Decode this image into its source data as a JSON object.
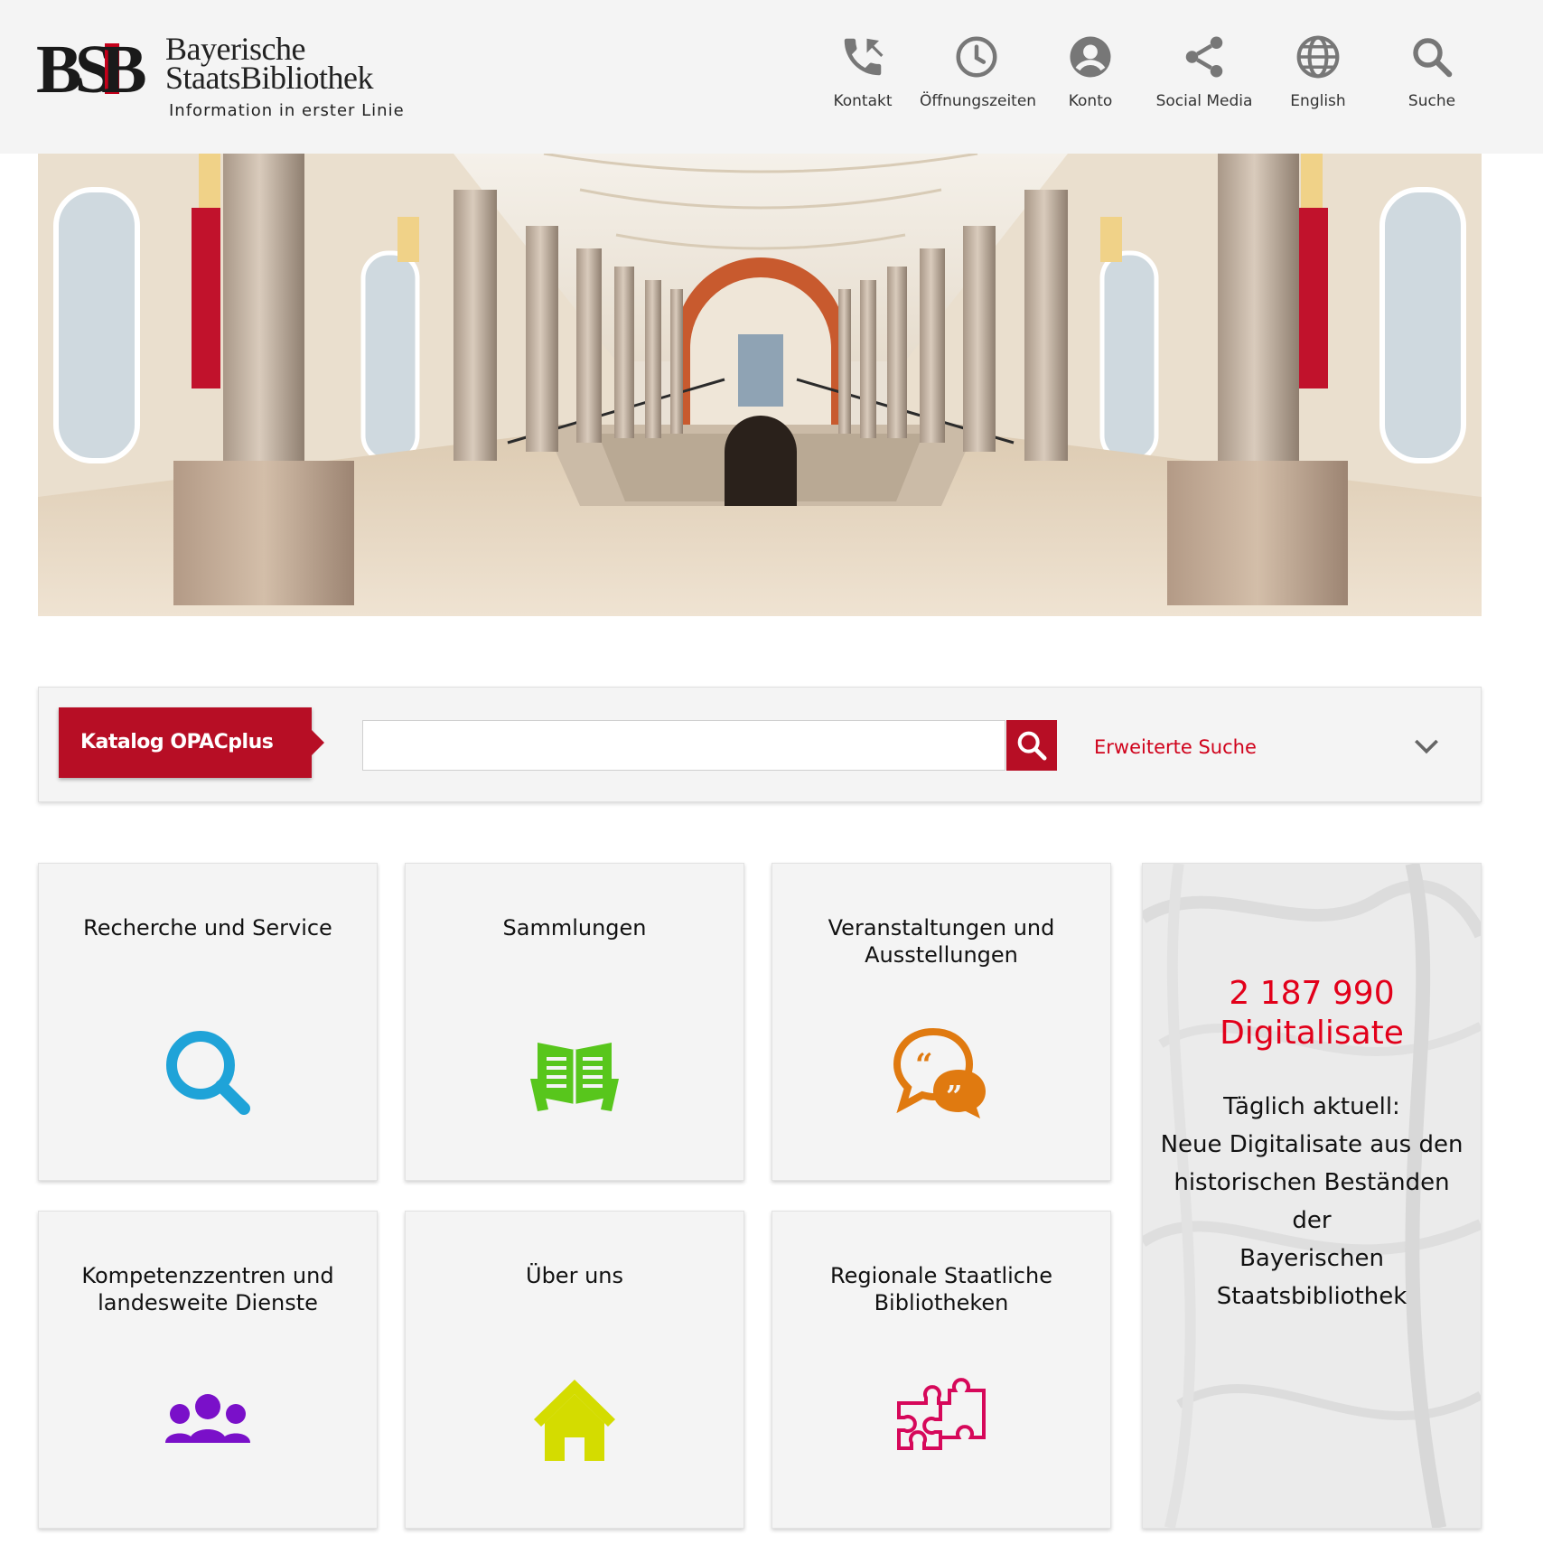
{
  "header": {
    "logo_mark": "BSB",
    "logo_name_line1": "Bayerische",
    "logo_name_line2": "StaatsBibliothek",
    "logo_tagline": "Information in erster Linie",
    "nav": [
      {
        "label": "Kontakt",
        "icon": "phone-icon"
      },
      {
        "label": "Öffnungszeiten",
        "icon": "clock-icon"
      },
      {
        "label": "Konto",
        "icon": "account-icon"
      },
      {
        "label": "Social Media",
        "icon": "share-icon"
      },
      {
        "label": "English",
        "icon": "globe-icon"
      },
      {
        "label": "Suche",
        "icon": "search-icon"
      }
    ]
  },
  "search": {
    "catalog_label": "Katalog OPACplus",
    "input_value": "",
    "advanced_label": "Erweiterte Suche"
  },
  "tiles": [
    {
      "title": "Recherche und Service",
      "icon": "magnifier-icon",
      "color": "#1fa3d8"
    },
    {
      "title": "Sammlungen",
      "icon": "open-book-icon",
      "color": "#58c61c"
    },
    {
      "title": "Veranstaltungen und Ausstellungen",
      "icon": "speech-bubbles-icon",
      "color": "#e07a10"
    },
    {
      "title": "Kompetenzzentren und landesweite Dienste",
      "icon": "people-icon",
      "color": "#7a10c9"
    },
    {
      "title": "Über uns",
      "icon": "house-icon",
      "color": "#d4dc00"
    },
    {
      "title": "Regionale Staatliche Bibliotheken",
      "icon": "puzzle-icon",
      "color": "#d6085a"
    }
  ],
  "digitalisate": {
    "count": "2 187 990",
    "label": "Digitalisate",
    "text_line1": "Täglich aktuell:",
    "text_line2": "Neue Digitalisate aus den",
    "text_line3": "historischen Beständen der",
    "text_line4": "Bayerischen",
    "text_line5": "Staatsbibliothek"
  },
  "colors": {
    "brand_red": "#b70e25",
    "link_red": "#e2001a",
    "header_bg": "#f4f4f4"
  }
}
